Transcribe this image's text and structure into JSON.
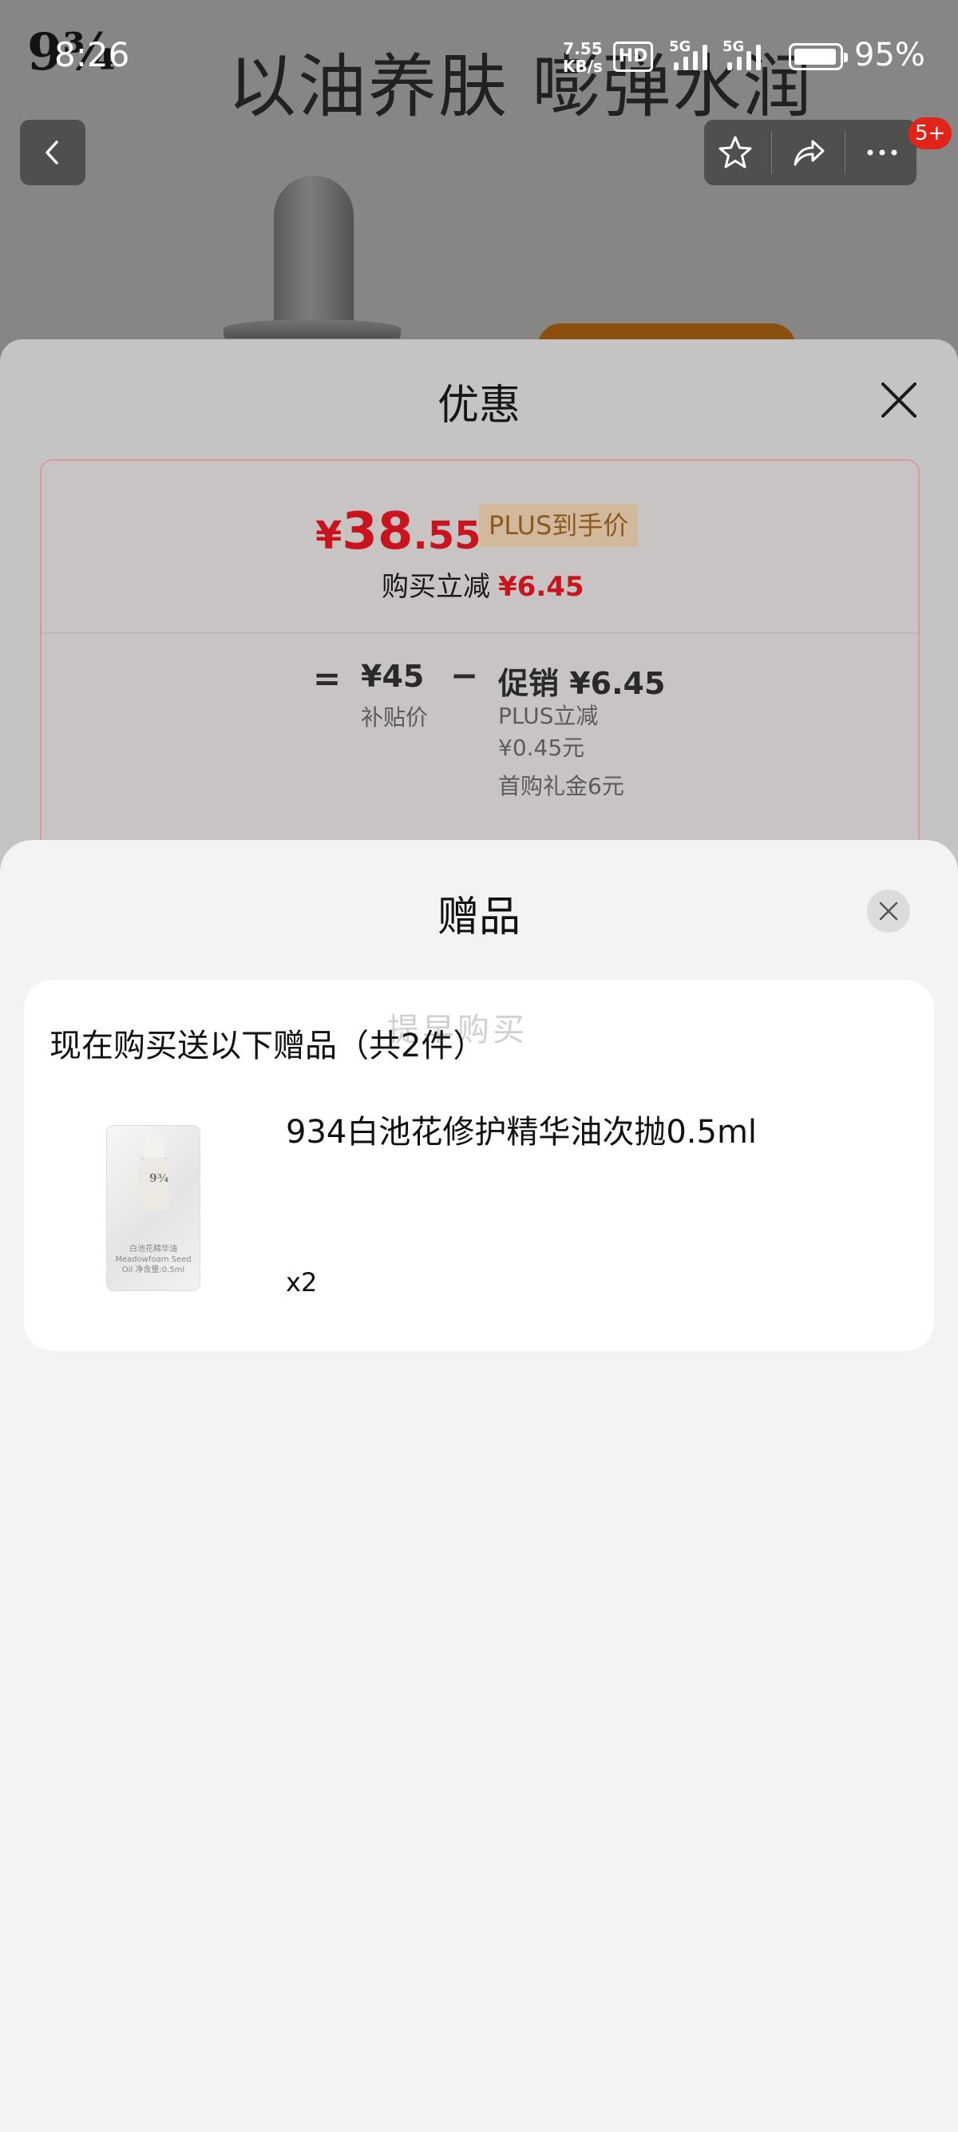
{
  "status_bar": {
    "time": "8:26",
    "net_speed_value": "7.55",
    "net_speed_unit": "KB/s",
    "hd_label": "HD",
    "sim1_label": "5G",
    "sim2_label": "5G",
    "battery_percent": "95%"
  },
  "background_page": {
    "brand_logo": "9¾",
    "hero_text": "以油养肤 嘭弹水润"
  },
  "top_nav": {
    "cart_badge": "5+",
    "icons": [
      "back-icon",
      "star-icon",
      "share-icon",
      "more-icon"
    ]
  },
  "discount_sheet": {
    "title": "优惠",
    "final_price_yen": "¥",
    "final_price_int": "38",
    "final_price_dec": ".55",
    "plus_tag": "PLUS到手价",
    "reduce_label": "购买立减",
    "reduce_amount": "¥6.45",
    "equals_sign": "=",
    "subsidy_price": "¥45",
    "subsidy_label": "补贴价",
    "minus_sign": "−",
    "promo_line": "促销 ¥6.45",
    "promo_plus": "PLUS立减¥0.45元",
    "promo_gift": "首购礼金6元"
  },
  "gift_sheet": {
    "title": "赠品",
    "ghost_text": "提早购买",
    "header": "现在购买送以下赠品（共2件）",
    "items": [
      {
        "name": "934白池花修护精华油次抛0.5ml",
        "quantity": "x2",
        "image_logo": "9¾",
        "image_print": "白池花精华油 Meadowfoam Seed Oil 净含量:0.5ml"
      }
    ]
  },
  "colors": {
    "price_red": "#c8141e",
    "badge_red": "#e2231a",
    "plus_gold_bg": "#d2b99c",
    "orange_accent": "#f08a1c",
    "sheet_bg": "#f3f3f3"
  }
}
